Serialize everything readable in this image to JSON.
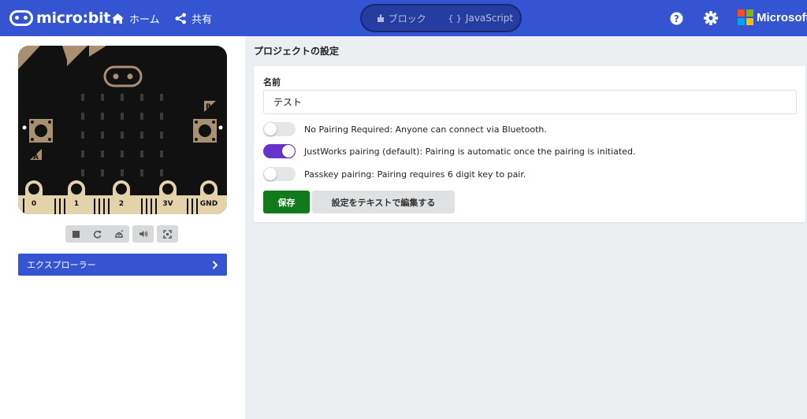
{
  "colors": {
    "brand": "#3454d1",
    "save": "#117a1a",
    "toggle_on": "#6633cc",
    "board_body": "#111111",
    "board_edge": "#e4d2aa"
  },
  "header": {
    "logo_text": "micro:bit",
    "home_label": "ホーム",
    "share_label": "共有",
    "editor_tabs": [
      {
        "label": "ブロック",
        "icon": "puzzle-icon",
        "selected": false
      },
      {
        "label": "JavaScript",
        "icon": "braces-icon",
        "selected": false
      }
    ],
    "help_icon": "help-icon",
    "settings_icon": "gear-icon",
    "brand_text": "Microsoft"
  },
  "simulator": {
    "pin_labels": [
      "0",
      "1",
      "2",
      "3V",
      "GND"
    ],
    "button_a": "A",
    "button_b": "B",
    "toolbar": [
      "stop-icon",
      "restart-icon",
      "slow-motion-icon",
      "volume-icon",
      "fullscreen-icon"
    ]
  },
  "explorer": {
    "label": "エクスプローラー"
  },
  "settings": {
    "page_title": "プロジェクトの設定",
    "name_label": "名前",
    "name_value": "テスト",
    "options": [
      {
        "label": "No Pairing Required: Anyone can connect via Bluetooth.",
        "on": false
      },
      {
        "label": "JustWorks pairing (default): Pairing is automatic once the pairing is initiated.",
        "on": true
      },
      {
        "label": "Passkey pairing: Pairing requires 6 digit key to pair.",
        "on": false
      }
    ],
    "save_label": "保存",
    "edit_text_label": "設定をテキストで編集する"
  }
}
